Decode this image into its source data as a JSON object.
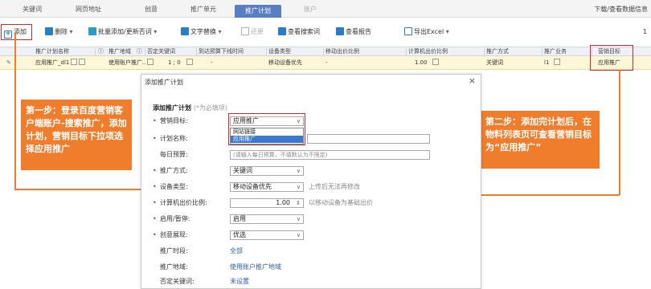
{
  "tabs": [
    {
      "label": "关键词"
    },
    {
      "label": "网页地址"
    },
    {
      "label": "创意"
    },
    {
      "label": "推广单元"
    },
    {
      "label": "推广计划"
    },
    {
      "label": "账户"
    }
  ],
  "top_right_link": "下载/查看数据信息",
  "toolbar": {
    "add": "添加",
    "delete": "删除",
    "batch": "批量添加/更新否词",
    "text_replace": "文字替换",
    "restore": "还原",
    "view_search": "查看搜索词",
    "view_report": "查看报告",
    "export": "导出Excel",
    "page_num": "1"
  },
  "grid": {
    "headers": [
      "推广计划名称",
      "推广地域",
      "否定关键词",
      "到达预算下线时间",
      "设备类型",
      "移动出价比例",
      "计算机出价比例",
      "推广方式",
      "推广业务",
      "营销目标"
    ],
    "row": {
      "name": "应用推广_dl1",
      "region": "使用账户推广..",
      "negative": "1 ; 0",
      "budget_time": "-",
      "device": "移动设备优先",
      "mobile_ratio": "-",
      "pc_ratio": "1.00",
      "method": "关键词",
      "business": "l1",
      "target": "应用推广"
    }
  },
  "callouts": {
    "left": "第一步：登录百度营销客户端账户-搜索推广，添加计划，营销目标下拉项选择应用推广",
    "right": "第二步：添加完计划后，在物料列表页可查看营销目标为“应用推广”"
  },
  "modal": {
    "title": "添加推广计划",
    "close": "×",
    "section_title": "添加推广计划",
    "section_note": "(*为必填项)",
    "fields": {
      "target_label": "营销目标:",
      "target_value": "应用推广",
      "target_options": [
        "网站链接",
        "应用推广"
      ],
      "name_label": "计划名称:",
      "budget_label": "每日预算:",
      "budget_placeholder": "(请输入每日预算，不填默认为不限定)",
      "method_label": "推广方式:",
      "method_value": "关键词",
      "device_label": "设备类型:",
      "device_value": "移动设备优先",
      "device_hint": "上传后无法再修改",
      "pc_ratio_label": "计算机出价比例:",
      "pc_ratio_value": "1.00",
      "pc_ratio_hint": "以移动设备为基础出价",
      "status_label": "启用/暂停:",
      "status_value": "启用",
      "creative_label": "创意展现:",
      "creative_value": "优选",
      "time_label": "推广时段:",
      "time_value": "全部",
      "region_label": "推广地域:",
      "region_value": "使用账户推广地域",
      "negative_label": "否定关键词:",
      "negative_value": "未设置"
    }
  },
  "colors": {
    "accent": "#5a7ec2",
    "callout": "#ef7d2b",
    "highlight": "#d9262e",
    "link": "#2f5aa8"
  }
}
